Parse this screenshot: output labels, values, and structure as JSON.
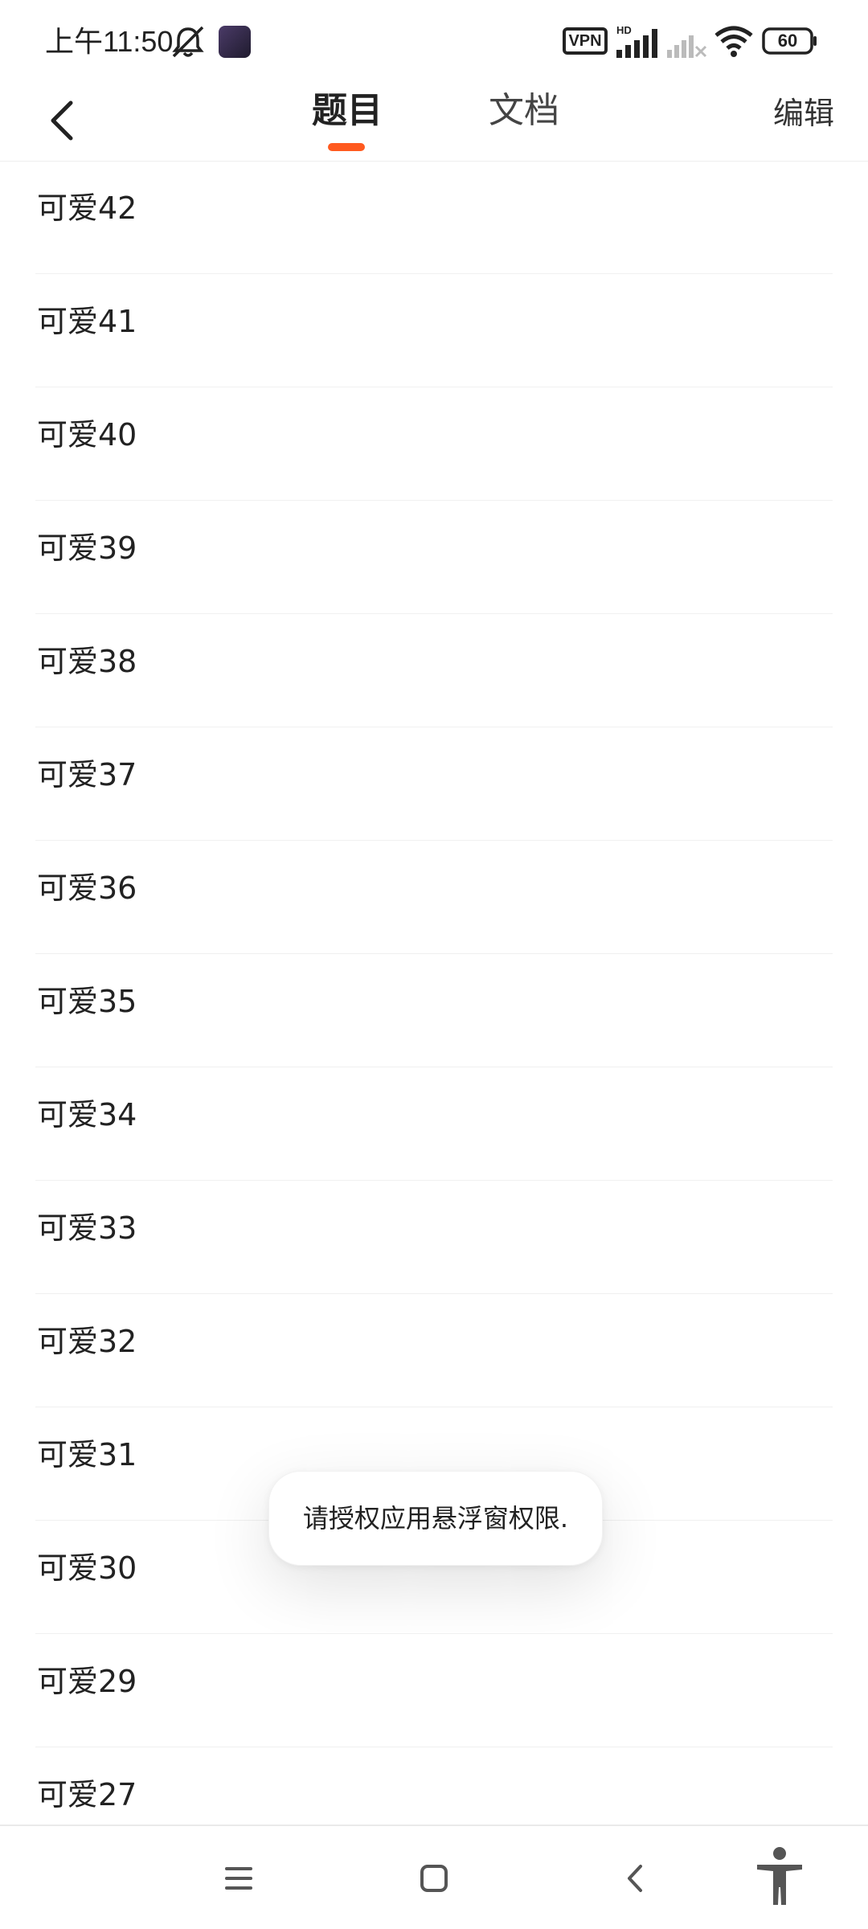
{
  "status_bar": {
    "time": "上午11:50",
    "vpn_label": "VPN",
    "hd_label": "HD",
    "battery": "60",
    "icons": [
      "bell-muted-icon",
      "app-thumbnail-icon",
      "vpn-icon",
      "signal-icon",
      "signal-no-sim-icon",
      "wifi-icon",
      "battery-icon"
    ]
  },
  "header": {
    "tabs": [
      {
        "label": "题目",
        "active": true
      },
      {
        "label": "文档",
        "active": false
      }
    ],
    "edit_label": "编辑",
    "accent_color": "#ff5a1f"
  },
  "list": {
    "items": [
      {
        "label": "可爱42"
      },
      {
        "label": "可爱41"
      },
      {
        "label": "可爱40"
      },
      {
        "label": "可爱39"
      },
      {
        "label": "可爱38"
      },
      {
        "label": "可爱37"
      },
      {
        "label": "可爱36"
      },
      {
        "label": "可爱35"
      },
      {
        "label": "可爱34"
      },
      {
        "label": "可爱33"
      },
      {
        "label": "可爱32"
      },
      {
        "label": "可爱31"
      },
      {
        "label": "可爱30"
      },
      {
        "label": "可爱29"
      },
      {
        "label": "可爱27"
      }
    ]
  },
  "toast": {
    "text": "请授权应用悬浮窗权限."
  },
  "nav_bar": {
    "icons": [
      "menu-icon",
      "home-icon",
      "back-icon",
      "accessibility-icon"
    ]
  }
}
